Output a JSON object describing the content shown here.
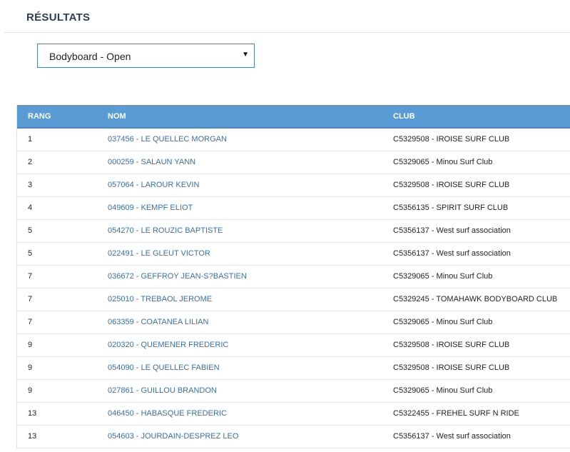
{
  "page": {
    "title": "RÉSULTATS"
  },
  "category_select": {
    "value": "Bodyboard - Open",
    "caret": "▼"
  },
  "table": {
    "headers": [
      "RANG",
      "NOM",
      "CLUB"
    ],
    "rows": [
      {
        "rang": "1",
        "nom": "037456 - LE QUELLEC MORGAN",
        "club": "C5329508 - IROISE SURF CLUB"
      },
      {
        "rang": "2",
        "nom": "000259 - SALAUN YANN",
        "club": "C5329065 - Minou Surf Club"
      },
      {
        "rang": "3",
        "nom": "057064 - LAROUR KEVIN",
        "club": "C5329508 - IROISE SURF CLUB"
      },
      {
        "rang": "4",
        "nom": "049609 - KEMPF ELIOT",
        "club": "C5356135 - SPIRIT SURF CLUB"
      },
      {
        "rang": "5",
        "nom": "054270 - LE ROUZIC BAPTISTE",
        "club": "C5356137 - West surf association"
      },
      {
        "rang": "5",
        "nom": "022491 - LE GLEUT VICTOR",
        "club": "C5356137 - West surf association"
      },
      {
        "rang": "7",
        "nom": "036672 - GEFFROY JEAN-S?BASTIEN",
        "club": "C5329065 - Minou Surf Club"
      },
      {
        "rang": "7",
        "nom": "025010 - TREBAOL JEROME",
        "club": "C5329245 - TOMAHAWK BODYBOARD CLUB"
      },
      {
        "rang": "7",
        "nom": "063359 - COATANEA LILIAN",
        "club": "C5329065 - Minou Surf Club"
      },
      {
        "rang": "9",
        "nom": "020320 - QUEMENER FREDERIC",
        "club": "C5329508 - IROISE SURF CLUB"
      },
      {
        "rang": "9",
        "nom": "054090 - LE QUELLEC FABIEN",
        "club": "C5329508 - IROISE SURF CLUB"
      },
      {
        "rang": "9",
        "nom": "027861 - GUILLOU BRANDON",
        "club": "C5329065 - Minou Surf Club"
      },
      {
        "rang": "13",
        "nom": "046450 - HABASQUE FREDERIC",
        "club": "C5322455 - FREHEL SURF N RIDE"
      },
      {
        "rang": "13",
        "nom": "054603 - JOURDAIN-DESPREZ LEO",
        "club": "C5356137 - West surf association"
      }
    ]
  },
  "colors": {
    "header_bg": "#5b9bd5",
    "link": "#3a6fa8",
    "title": "#2a3f54"
  }
}
